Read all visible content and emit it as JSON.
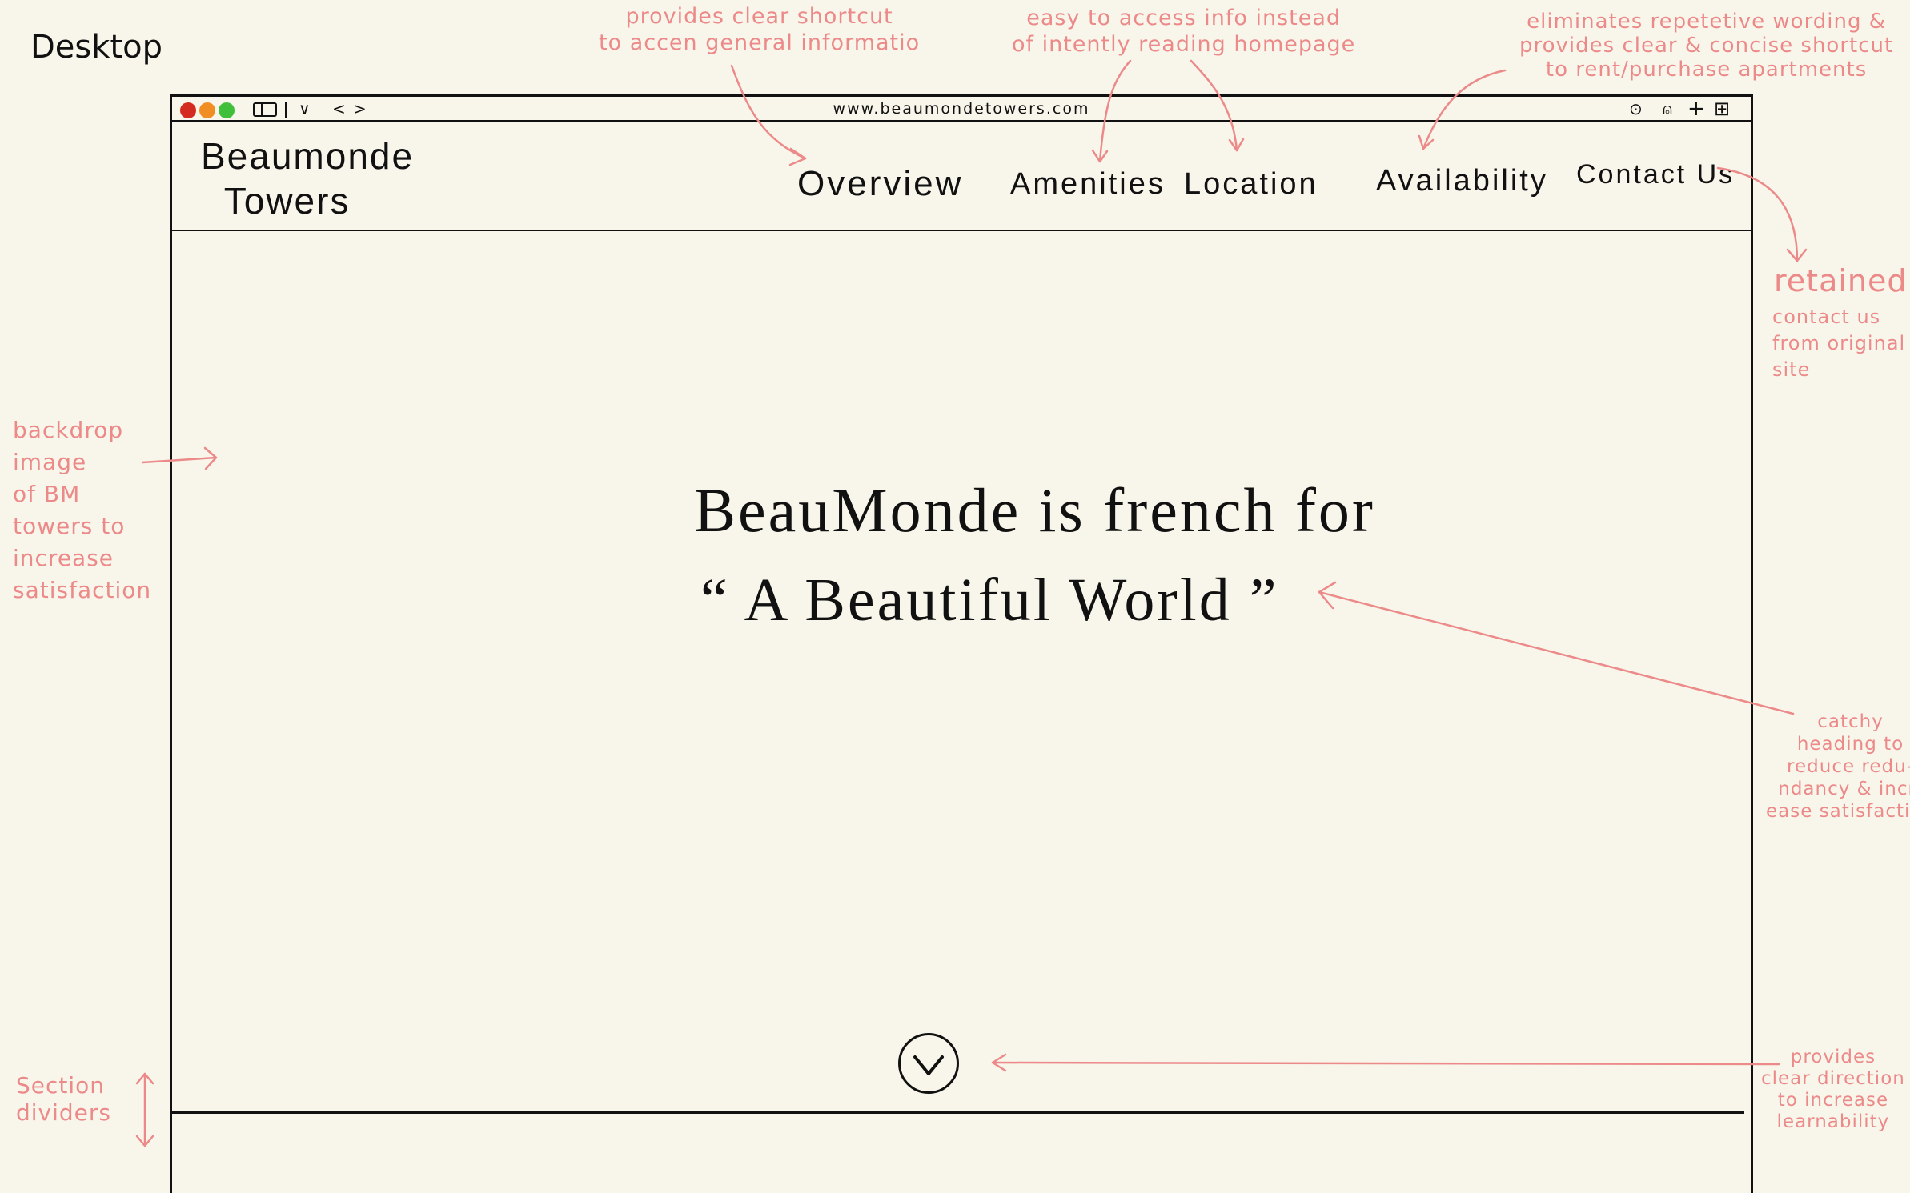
{
  "page_label": "Desktop",
  "browser": {
    "url": "www.beaumondetowers.com",
    "back_glyph": "<",
    "forward_glyph": ">",
    "dropdown_glyph": "∨",
    "download_glyph": "⊙",
    "share_glyph": "⍝",
    "new_tab_glyph": "+",
    "tabs_glyph": "⊞",
    "window_colors": {
      "close": "#d42b20",
      "minimize": "#f08d23",
      "zoom": "#3fbf3a"
    }
  },
  "site": {
    "logo_line1": "Beaumonde",
    "logo_line2": "Towers",
    "nav": [
      "Overview",
      "Amenities",
      "Location",
      "Availability",
      "Contact Us"
    ],
    "hero_line1": "BeauMonde is french for",
    "hero_line2": "“ A Beautiful World ”",
    "scroll_icon": "chevron-down-circle"
  },
  "annotations": {
    "overview": "provides clear shortcut\nto accen general informatio",
    "amenities_location": "easy to access info instead\nof intently reading homepage",
    "availability": "eliminates repetetive wording &\nprovides clear & concise shortcut\nto rent/purchase apartments",
    "contact_title": "retained",
    "contact_body": "contact us\nfrom original\nsite",
    "backdrop": "backdrop\nimage\nof BM\ntowers to\nincrease\nsatisfaction",
    "heading": "catchy\nheading to\nreduce redu-\nndancy & incr-\nease satisfaction",
    "scroll": "provides\nclear direction\nto increase\nlearnability",
    "dividers": "Section\ndividers"
  },
  "colors": {
    "background": "#f8f6ea",
    "ink": "#111111",
    "annotation": "#ec8a8a"
  }
}
